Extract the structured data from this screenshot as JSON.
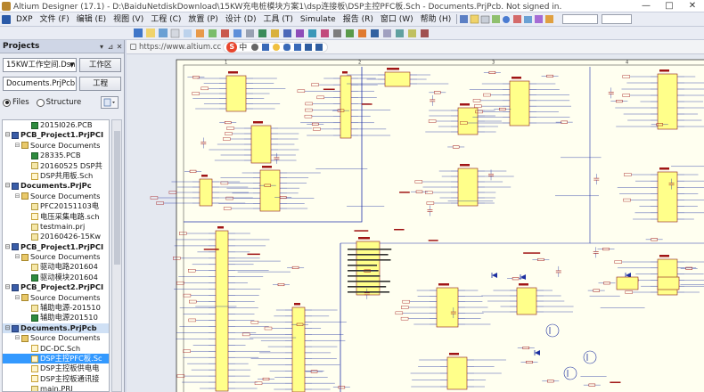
{
  "window": {
    "title": "Altium Designer (17.1) - D:\\BaiduNetdiskDownload\\15KW充电桩模块方案1\\dsp连接板\\DSP主控PFC板.Sch - Documents.PrjPcb. Not signed in.",
    "controls": [
      "—",
      "□",
      "✕"
    ]
  },
  "menu": {
    "items": [
      "DXP",
      "文件 (F)",
      "编辑 (E)",
      "视图 (V)",
      "工程 (C)",
      "放置 (P)",
      "设计 (D)",
      "工具 (T)",
      "Simulate",
      "报告 (R)",
      "窗口 (W)",
      "帮助 (H)"
    ]
  },
  "projects_panel": {
    "title": "Projects",
    "workspace_combo": "15KW工作空间.DsnW",
    "workspace_button": "工作区",
    "project_combo": "Documents.PrjPcb",
    "project_button": "工程",
    "radio_files": "Files",
    "radio_structure": "Structure",
    "tree": [
      {
        "label": "2015I026.PCB",
        "icon": "pcb",
        "level": 2,
        "style": ""
      },
      {
        "label": "PCB_Project1.PrjPCI",
        "icon": "proj",
        "level": 0,
        "style": "bold"
      },
      {
        "label": "Source Documents",
        "icon": "folder",
        "level": 1,
        "style": ""
      },
      {
        "label": "28335.PCB",
        "icon": "pcb",
        "level": 2,
        "style": ""
      },
      {
        "label": "20160525 DSP共",
        "icon": "doc",
        "level": 2,
        "style": ""
      },
      {
        "label": "DSP共用板.Sch",
        "icon": "sch",
        "level": 2,
        "style": ""
      },
      {
        "label": "Documents.PrjPc",
        "icon": "proj",
        "level": 0,
        "style": "bold"
      },
      {
        "label": "Source Documents",
        "icon": "folder",
        "level": 1,
        "style": ""
      },
      {
        "label": "PFC20151103电",
        "icon": "doc",
        "level": 2,
        "style": ""
      },
      {
        "label": "电压采集电路.sch",
        "icon": "sch",
        "level": 2,
        "style": ""
      },
      {
        "label": "testmain.prj",
        "icon": "doc",
        "level": 2,
        "style": ""
      },
      {
        "label": "20160426-15Kw",
        "icon": "doc",
        "level": 2,
        "style": ""
      },
      {
        "label": "PCB_Project1.PrjPCI",
        "icon": "proj",
        "level": 0,
        "style": "bold"
      },
      {
        "label": "Source Documents",
        "icon": "folder",
        "level": 1,
        "style": ""
      },
      {
        "label": "驱动电路201604",
        "icon": "doc",
        "level": 2,
        "style": ""
      },
      {
        "label": "驱动模块201604",
        "icon": "pcb",
        "level": 2,
        "style": ""
      },
      {
        "label": "PCB_Project2.PrjPCI",
        "icon": "proj",
        "level": 0,
        "style": "bold"
      },
      {
        "label": "Source Documents",
        "icon": "folder",
        "level": 1,
        "style": ""
      },
      {
        "label": "辅助电源-201510",
        "icon": "doc",
        "level": 2,
        "style": ""
      },
      {
        "label": "辅助电源201510",
        "icon": "pcb",
        "level": 2,
        "style": ""
      },
      {
        "label": "Documents.PrjPcb",
        "icon": "proj",
        "level": 0,
        "style": "bold hl"
      },
      {
        "label": "Source Documents",
        "icon": "folder",
        "level": 1,
        "style": ""
      },
      {
        "label": "DC-DC.Sch",
        "icon": "sch",
        "level": 2,
        "style": ""
      },
      {
        "label": "DSP主控PFC板.Sc",
        "icon": "sch",
        "level": 2,
        "style": "sel"
      },
      {
        "label": "DSP主控板供电电",
        "icon": "sch",
        "level": 2,
        "style": ""
      },
      {
        "label": "DSP主控板通讯接",
        "icon": "sch",
        "level": 2,
        "style": ""
      },
      {
        "label": "main.PRJ",
        "icon": "doc",
        "level": 2,
        "style": ""
      }
    ]
  },
  "address_bar": {
    "url": "https://www.altium.cc",
    "ime_brand": "S",
    "ime_lang": "中"
  },
  "colors": {
    "sheet_bg": "#fffff0",
    "wire": "#1c2fa0",
    "component_fill": "#ffff8a",
    "component_outline": "#8b1a1a",
    "label_red": "#a01515"
  },
  "schematic": {
    "ruler_top": [
      "1",
      "2",
      "3",
      "4"
    ]
  }
}
